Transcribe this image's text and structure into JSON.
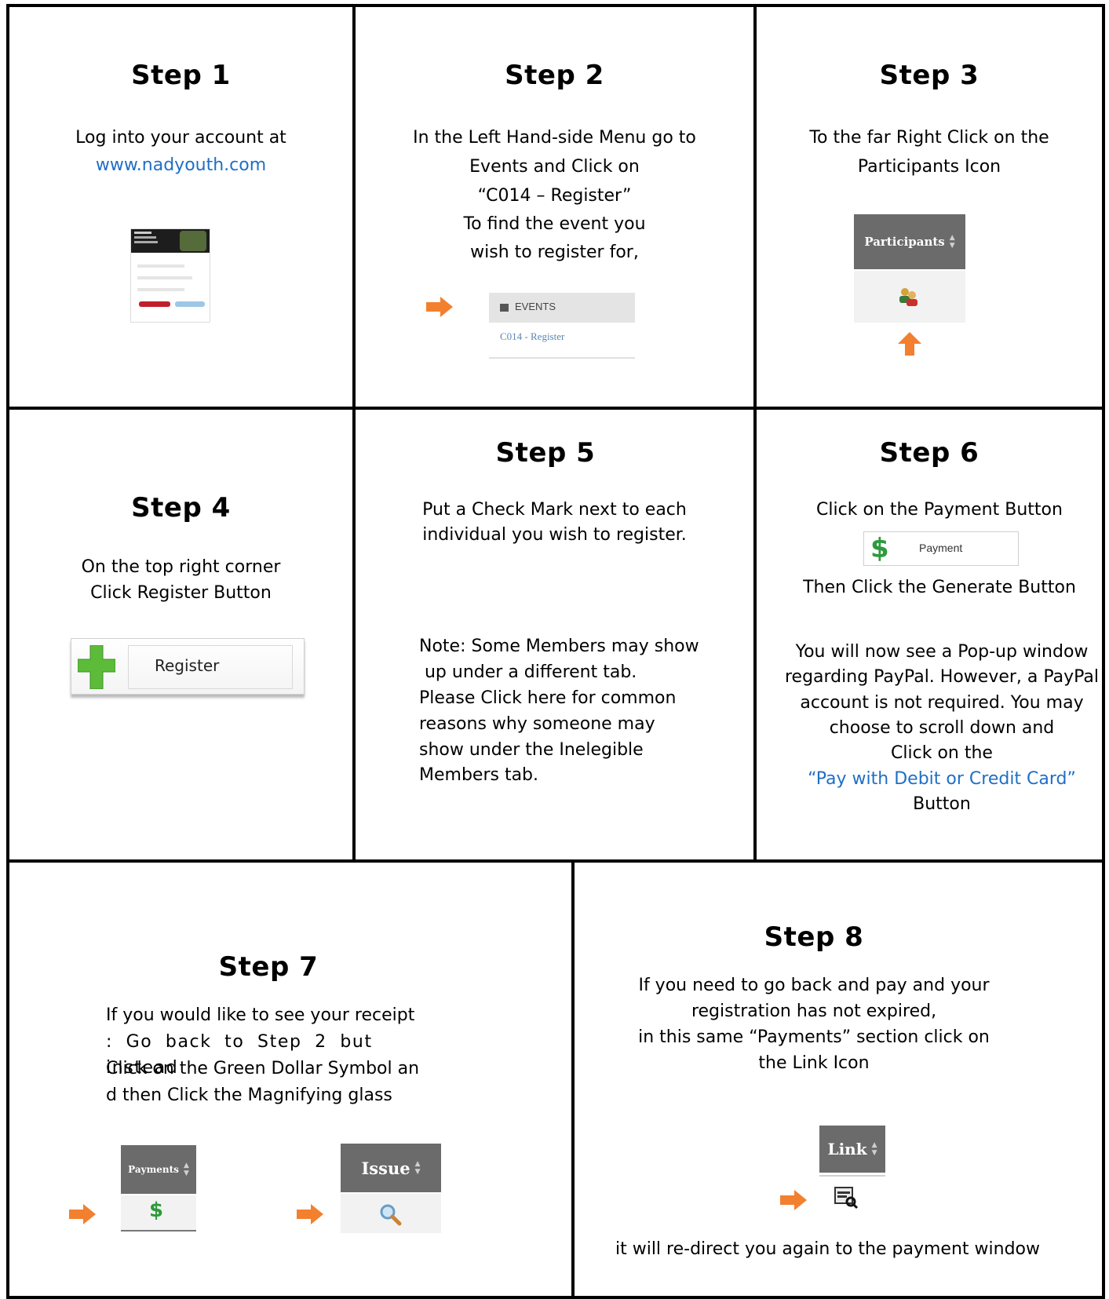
{
  "colors": {
    "accent_orange": "#f2802f",
    "link_blue": "#1f6fc5",
    "header_gray": "#6b6b6b",
    "dollar_green": "#2e9a3d"
  },
  "step1": {
    "title": "Step 1",
    "line1": "Log into your account at",
    "link": "www.nadyouth.com"
  },
  "step2": {
    "title": "Step 2",
    "lines": [
      "In the Left Hand-side Menu go to",
      "Events and Click on",
      "“C014 – Register”",
      "To find the event you",
      "wish to register for,"
    ],
    "menu_header": "EVENTS",
    "menu_item": "C014 - Register"
  },
  "step3": {
    "title": "Step 3",
    "lines": [
      "To the far Right Click on the",
      "Participants Icon"
    ],
    "column_header": "Participants",
    "icon": "participants-icon"
  },
  "step4": {
    "title": "Step 4",
    "lines": [
      "On the top right corner",
      "Click Register Button"
    ],
    "button_label": "Register"
  },
  "step5": {
    "title": "Step 5",
    "lines": [
      "Put a Check Mark next to each",
      "individual you wish to register."
    ],
    "note_lines": [
      "Note: Some Members may show",
      " up under a different tab.",
      "Please Click here for common",
      "reasons why someone may",
      "show under the Inelegible",
      "Members tab."
    ]
  },
  "step6": {
    "title": "Step 6",
    "line1": "Click on the Payment Button",
    "button_label": "Payment",
    "line2": "Then Click the Generate Button",
    "lines": [
      "You will now see a Pop-up window",
      "regarding PayPal. However, a PayPal",
      "account is not required. You may",
      "choose to scroll down and",
      "Click on the"
    ],
    "link": "“Pay with Debit or Credit Card”",
    "last": "Button"
  },
  "step7": {
    "title": "Step 7",
    "lines": [
      "If you would like to see your receipt",
      ": Go back to Step 2 but instead",
      "Click on the Green Dollar Symbol an",
      "d then Click the Magnifying glass"
    ],
    "payments_header": "Payments",
    "issue_header": "Issue"
  },
  "step8": {
    "title": "Step 8",
    "lines": [
      "If you need to go back and pay and your",
      "registration has not expired,",
      "in this same “Payments” section click on",
      "the Link Icon"
    ],
    "link_header": "Link",
    "last": "it will re-direct you again to the payment window"
  }
}
